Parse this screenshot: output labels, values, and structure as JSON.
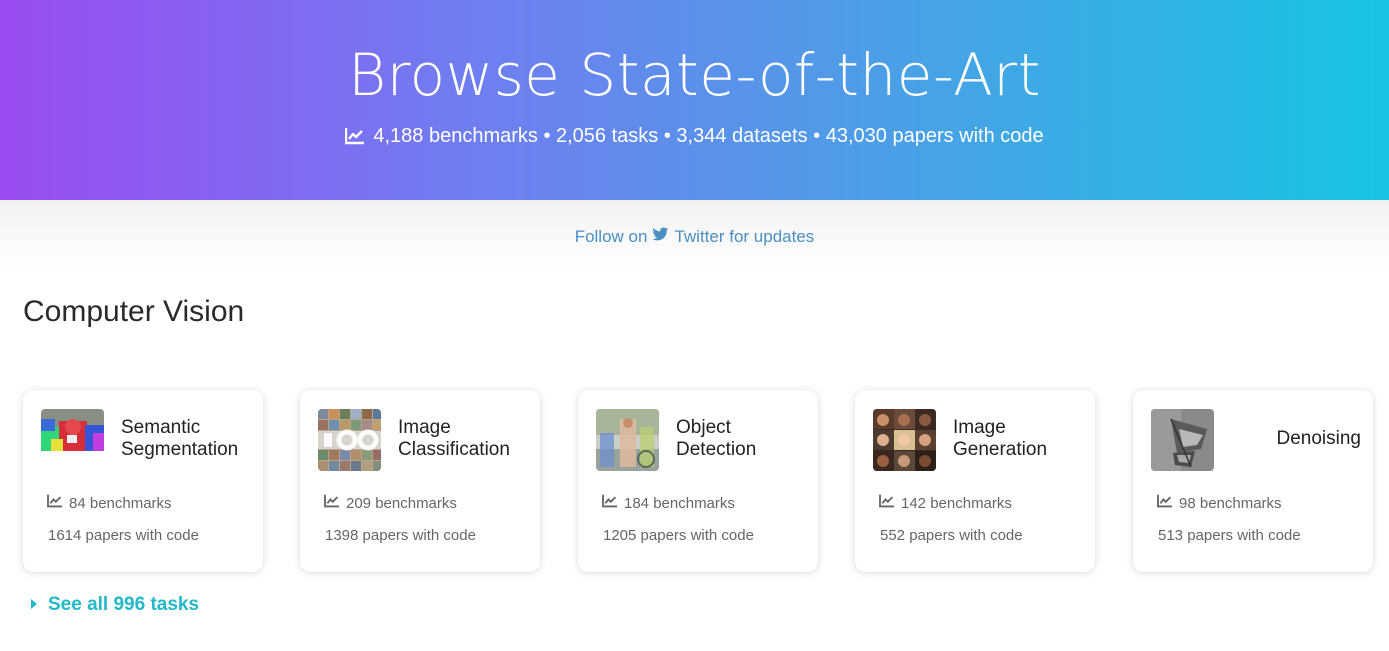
{
  "hero": {
    "title": "Browse State-of-the-Art",
    "stats": "4,188 benchmarks • 2,056 tasks • 3,344 datasets • 43,030 papers with code",
    "stats_icon": "line-chart-icon",
    "gradient_start": "#9b4cf2",
    "gradient_end": "#17c4e2"
  },
  "follow": {
    "prefix": "Follow on",
    "link": "Twitter for updates",
    "icon": "twitter-icon",
    "color": "#4a90c2"
  },
  "section": {
    "title": "Computer Vision"
  },
  "cards": [
    {
      "title": "Semantic Segmentation",
      "benchmarks": "84 benchmarks",
      "papers": "1614 papers with code",
      "image": "semantic-segmentation-thumbnail"
    },
    {
      "title": "Image Classification",
      "benchmarks": "209 benchmarks",
      "papers": "1398 papers with code",
      "image": "image-classification-thumbnail"
    },
    {
      "title": "Object Detection",
      "benchmarks": "184 benchmarks",
      "papers": "1205 papers with code",
      "image": "object-detection-thumbnail"
    },
    {
      "title": "Image Generation",
      "benchmarks": "142 benchmarks",
      "papers": "552 papers with code",
      "image": "image-generation-thumbnail"
    },
    {
      "title": "Denoising",
      "benchmarks": "98 benchmarks",
      "papers": "513 papers with code",
      "image": "denoising-thumbnail"
    }
  ],
  "see_all": {
    "label": "See all 996 tasks",
    "icon": "caret-right-icon",
    "color": "#21b9c9"
  }
}
